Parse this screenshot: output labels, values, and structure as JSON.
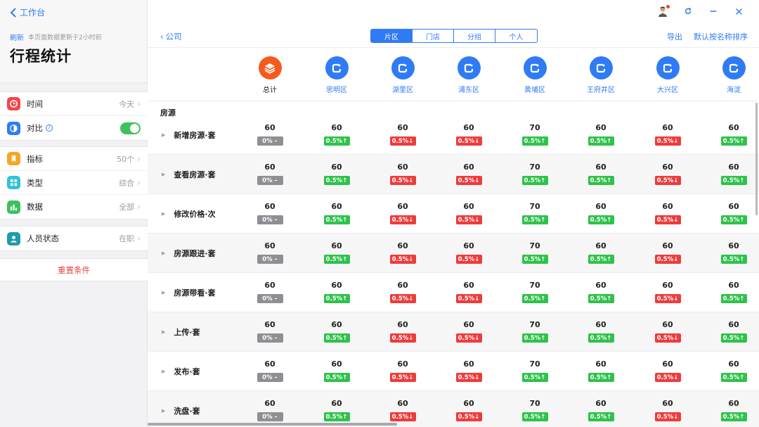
{
  "sidebar": {
    "back_label": "工作台",
    "refresh_label": "刷新",
    "update_note": "本页面数据更新于2小时前",
    "title": "行程统计",
    "group1": [
      {
        "label": "时间",
        "value": "今天",
        "icon": "clock-icon",
        "color": "#f04848"
      },
      {
        "label": "对比",
        "value": "",
        "icon": "compare-icon",
        "color": "#2f7bf5",
        "toggle": true
      }
    ],
    "group2": [
      {
        "label": "指标",
        "value": "50个",
        "icon": "bookmark-icon",
        "color": "#f5a623"
      },
      {
        "label": "类型",
        "value": "综合",
        "icon": "grid-icon",
        "color": "#2ec4d6"
      },
      {
        "label": "数据",
        "value": "全部",
        "icon": "bar-chart-icon",
        "color": "#3cc15c"
      }
    ],
    "group3": [
      {
        "label": "人员状态",
        "value": "在职",
        "icon": "person-icon",
        "color": "#1f9bb0"
      }
    ],
    "reset_label": "重置条件"
  },
  "topbar": {
    "back_label": "公司",
    "tabs": [
      "片区",
      "门店",
      "分组",
      "个人"
    ],
    "active_tab": 0,
    "export_label": "导出",
    "sort_label": "默认按名称排序"
  },
  "columns": [
    "总计",
    "思明区",
    "湖里区",
    "浦东区",
    "黄埔区",
    "王府井区",
    "大兴区",
    "海淀"
  ],
  "section_title": "房源",
  "rows": [
    {
      "label": "新增房源·套"
    },
    {
      "label": "查看房源·套"
    },
    {
      "label": "修改价格·次"
    },
    {
      "label": "房源跟进·套"
    },
    {
      "label": "房源带看·套"
    },
    {
      "label": "上传·套"
    },
    {
      "label": "发布·套"
    },
    {
      "label": "洗盘·套"
    }
  ],
  "cell_values": [
    "60",
    "60",
    "60",
    "60",
    "70",
    "60",
    "60",
    "60"
  ],
  "cell_badges": [
    {
      "text": "0% –",
      "trend": "flat"
    },
    {
      "text": "0.5%↑",
      "trend": "up"
    },
    {
      "text": "0.5%↓",
      "trend": "down"
    },
    {
      "text": "0.5%↓",
      "trend": "down"
    },
    {
      "text": "0.5%↑",
      "trend": "up"
    },
    {
      "text": "0.5%↑",
      "trend": "up"
    },
    {
      "text": "0.5%↓",
      "trend": "down"
    },
    {
      "text": "0.5%↑",
      "trend": "up"
    }
  ],
  "colors": {
    "accent": "#2f7bf5",
    "up": "#2fc24b",
    "down": "#ef3b3b",
    "flat": "#8e8e93",
    "total_icon": "#f45a1e"
  }
}
